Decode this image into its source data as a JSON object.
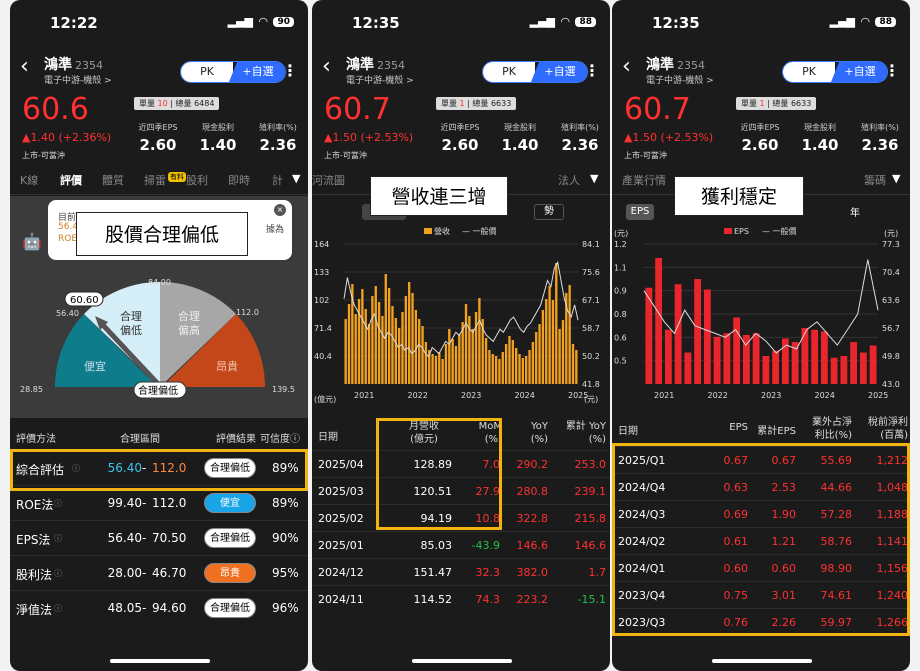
{
  "stock": {
    "name": "鴻準",
    "code": "2354",
    "sector": "電子中游-機殼 >",
    "pk": "PK",
    "watch": "+自選",
    "market": "上市-可當沖",
    "vol_label": "單量",
    "total_label": "總量",
    "eps_label": "近四季EPS",
    "div_label": "現金股利",
    "yield_label": "殖利率(%)"
  },
  "p1": {
    "time": "12:22",
    "battery": "90",
    "price": "60.6",
    "change": "▲1.40 (+2.36%)",
    "unit_vol": "10",
    "total_vol": "6484",
    "eps": "2.60",
    "div": "1.40",
    "yield": "2.36",
    "tabs": [
      "K線",
      "評價",
      "體質",
      "掃雷",
      "股利",
      "即時",
      "計"
    ],
    "hot": "有料",
    "bubble": [
      "目前",
      "56.4",
      "ROE",
      "據為"
    ],
    "callout": "股價合理偏低",
    "gauge": {
      "top": "84.00",
      "marker": "60.60",
      "left": "56.40",
      "right": "112.0",
      "min": "28.85",
      "max": "139.5",
      "seg_cheap": "便宜",
      "seg_low": "合理\n偏低",
      "seg_high": "合理\n偏高",
      "seg_exp": "昂貴",
      "badge": "合理偏低",
      "colors": {
        "cheap": "#0f7c8c",
        "low": "#d6eef8",
        "high": "#a7a7a7",
        "exp": "#c4471a"
      }
    },
    "headers": [
      "評價方法",
      "合理區間",
      "評價結果",
      "可信度ⓘ"
    ],
    "rows": [
      {
        "method": "綜合評估",
        "lo": "56.40",
        "hi": "112.0",
        "result": "合理偏低",
        "conf": "89%"
      },
      {
        "method": "ROE法",
        "lo": "99.40",
        "hi": "112.0",
        "result": "便宜",
        "conf": "89%"
      },
      {
        "method": "EPS法",
        "lo": "56.40",
        "hi": "70.50",
        "result": "合理偏低",
        "conf": "90%"
      },
      {
        "method": "股利法",
        "lo": "28.00",
        "hi": "46.70",
        "result": "昂貴",
        "conf": "95%"
      },
      {
        "method": "淨值法",
        "lo": "48.05",
        "hi": "94.60",
        "result": "合理偏低",
        "conf": "96%"
      }
    ]
  },
  "p2": {
    "time": "12:35",
    "battery": "88",
    "price": "60.7",
    "change": "▲1.50 (+2.53%)",
    "unit_vol": "1",
    "total_vol": "6633",
    "eps": "2.60",
    "div": "1.40",
    "yield": "2.36",
    "tab_left": "河流圖",
    "tab_right": "法人",
    "callout": "營收連三增",
    "toggle_right": "勢",
    "legend_rev": "營收",
    "legend_price": "一般價",
    "left_unit": "(億元)",
    "right_unit": "(元)",
    "headers": [
      "日期",
      "月營收\n(億元)",
      "MoM\n(%)",
      "YoY\n(%)",
      "累計 YoY\n(%)"
    ],
    "rows": [
      {
        "date": "2025/04",
        "rev": "128.89",
        "mom": "7.0",
        "yoy": "290.2",
        "cyoy": "253.0"
      },
      {
        "date": "2025/03",
        "rev": "120.51",
        "mom": "27.9",
        "yoy": "280.8",
        "cyoy": "239.1"
      },
      {
        "date": "2025/02",
        "rev": "94.19",
        "mom": "10.8",
        "yoy": "322.8",
        "cyoy": "215.8"
      },
      {
        "date": "2025/01",
        "rev": "85.03",
        "mom": "-43.9",
        "yoy": "146.6",
        "cyoy": "146.6"
      },
      {
        "date": "2024/12",
        "rev": "151.47",
        "mom": "32.3",
        "yoy": "382.0",
        "cyoy": "1.7"
      },
      {
        "date": "2024/11",
        "rev": "114.52",
        "mom": "74.3",
        "yoy": "223.2",
        "cyoy": "-15.1"
      }
    ]
  },
  "p3": {
    "time": "12:35",
    "battery": "88",
    "price": "60.7",
    "change": "▲1.50 (+2.53%)",
    "unit_vol": "1",
    "total_vol": "6633",
    "eps": "2.60",
    "div": "1.40",
    "yield": "2.36",
    "tab_left": "產業行情",
    "tab_right": "籌碼",
    "callout": "獲利穩定",
    "toggle_eps": "EPS",
    "toggle_year": "年",
    "legend_eps": "EPS",
    "legend_price": "一般價",
    "left_unit": "(元)",
    "right_unit": "(元)",
    "headers": [
      "日期",
      "EPS",
      "累計EPS",
      "業外占淨\n利比(%)",
      "稅前淨利\n(百萬)"
    ],
    "rows": [
      {
        "date": "2025/Q1",
        "eps": "0.67",
        "ceps": "0.67",
        "ratio": "55.69",
        "pretax": "1,212"
      },
      {
        "date": "2024/Q4",
        "eps": "0.63",
        "ceps": "2.53",
        "ratio": "44.66",
        "pretax": "1,048"
      },
      {
        "date": "2024/Q3",
        "eps": "0.69",
        "ceps": "1.90",
        "ratio": "57.28",
        "pretax": "1,188"
      },
      {
        "date": "2024/Q2",
        "eps": "0.61",
        "ceps": "1.21",
        "ratio": "58.76",
        "pretax": "1,141"
      },
      {
        "date": "2024/Q1",
        "eps": "0.60",
        "ceps": "0.60",
        "ratio": "98.90",
        "pretax": "1,156"
      },
      {
        "date": "2023/Q4",
        "eps": "0.75",
        "ceps": "3.01",
        "ratio": "74.61",
        "pretax": "1,240"
      },
      {
        "date": "2023/Q3",
        "eps": "0.76",
        "ceps": "2.26",
        "ratio": "59.97",
        "pretax": "1,266"
      }
    ]
  },
  "chart_data": [
    {
      "type": "bar",
      "title": "",
      "x_ticks": [
        "2021",
        "2022",
        "2023",
        "2024",
        "2025"
      ],
      "y_left_ticks": [
        "164",
        "133",
        "102",
        "71.4",
        "40.4"
      ],
      "y_right_ticks": [
        "84.1",
        "75.6",
        "67.1",
        "58.7",
        "50.2",
        "41.8"
      ],
      "series": [
        {
          "name": "營收",
          "values": [
            95,
            110,
            130,
            100,
            115,
            125,
            105,
            90,
            118,
            128,
            112,
            98,
            140,
            126,
            108,
            96,
            86,
            102,
            118,
            132,
            121,
            104,
            95,
            88,
            72,
            64,
            60,
            58,
            62,
            55,
            70,
            85,
            75,
            68,
            80,
            92,
            110,
            98,
            85,
            102,
            116,
            95,
            76,
            64,
            60,
            58,
            55,
            62,
            70,
            78,
            74,
            66,
            60,
            56,
            58,
            64,
            72,
            82,
            90,
            104,
            115,
            128,
            114,
            151,
            85,
            94,
            121,
            129,
            70,
            64
          ]
        },
        {
          "name": "一般價",
          "values": [
            68,
            75,
            70,
            66,
            64,
            62,
            60,
            58,
            61,
            63,
            59,
            57,
            55,
            57,
            56,
            54,
            52,
            53,
            51,
            52,
            50,
            51,
            53,
            52,
            50,
            49,
            52,
            51,
            50,
            52,
            54,
            53,
            55,
            57,
            56,
            58,
            60,
            58,
            57,
            59,
            61,
            58,
            56,
            55,
            54,
            56,
            58,
            57,
            59,
            61,
            62,
            60,
            58,
            57,
            59,
            60,
            62,
            64,
            66,
            70,
            74,
            72,
            78,
            80,
            74,
            68,
            64,
            62,
            66,
            61
          ]
        }
      ]
    },
    {
      "type": "bar",
      "title": "",
      "x_ticks": [
        "2021",
        "2022",
        "2023",
        "2024",
        "2025"
      ],
      "y_left_ticks": [
        "1.2",
        "1.1",
        "0.9",
        "0.8",
        "0.6",
        "0.5"
      ],
      "y_right_ticks": [
        "77.3",
        "70.4",
        "63.6",
        "56.7",
        "49.8",
        "43.0"
      ],
      "series": [
        {
          "name": "EPS",
          "values": [
            1.0,
            1.17,
            0.76,
            1.02,
            0.63,
            1.05,
            0.99,
            0.72,
            0.74,
            0.83,
            0.73,
            0.74,
            0.61,
            0.64,
            0.71,
            0.69,
            0.77,
            0.76,
            0.75,
            0.6,
            0.61,
            0.69,
            0.63,
            0.67
          ]
        },
        {
          "name": "一般價",
          "values": [
            66,
            62,
            58,
            55,
            61,
            57,
            56,
            55,
            54,
            56,
            52,
            55,
            53,
            50,
            52,
            51,
            56,
            58,
            55,
            52,
            56,
            60,
            74,
            61
          ]
        }
      ]
    }
  ]
}
